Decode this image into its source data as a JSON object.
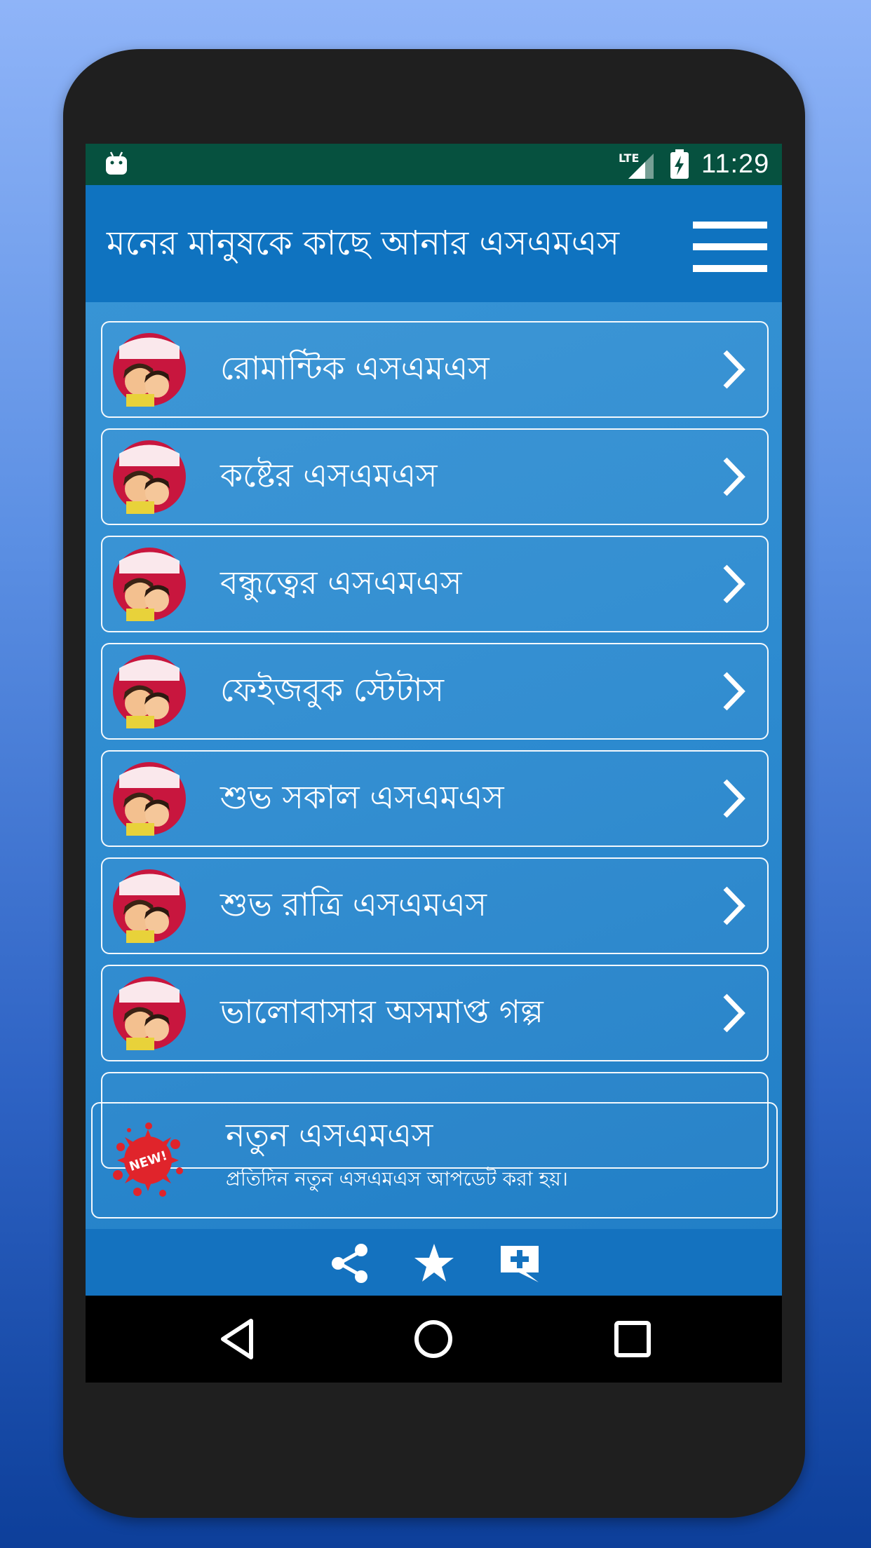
{
  "status_bar": {
    "time": "11:29",
    "network": "LTE"
  },
  "app_bar": {
    "title": "মনের মানুষকে কাছে আনার এসএমএস"
  },
  "menu": [
    {
      "label": "রোমান্টিক এসএমএস"
    },
    {
      "label": "কষ্টের এসএমএস"
    },
    {
      "label": "বন্ধুত্বের এসএমএস"
    },
    {
      "label": "ফেইজবুক স্টেটাস"
    },
    {
      "label": "শুভ সকাল এসএমএস"
    },
    {
      "label": "শুভ রাত্রি এসএমএস"
    },
    {
      "label": "ভালোবাসার অসমাপ্ত গল্প"
    }
  ],
  "new_sms": {
    "badge": "NEW!",
    "title": "নতুন এসএমএস",
    "subtitle": "প্রতিদিন নতুন এসএমএস আপডেট করা হয়।"
  },
  "bottom_icons": [
    "share-icon",
    "star-icon",
    "add-message-icon"
  ],
  "nav_icons": [
    "back-icon",
    "home-icon",
    "recents-icon"
  ],
  "colors": {
    "status_bar": "#06513f",
    "app_bar": "#0f73c0",
    "content": "#2d8bd0",
    "bottom_bar": "#1472bf",
    "nav_bar": "#000000"
  }
}
